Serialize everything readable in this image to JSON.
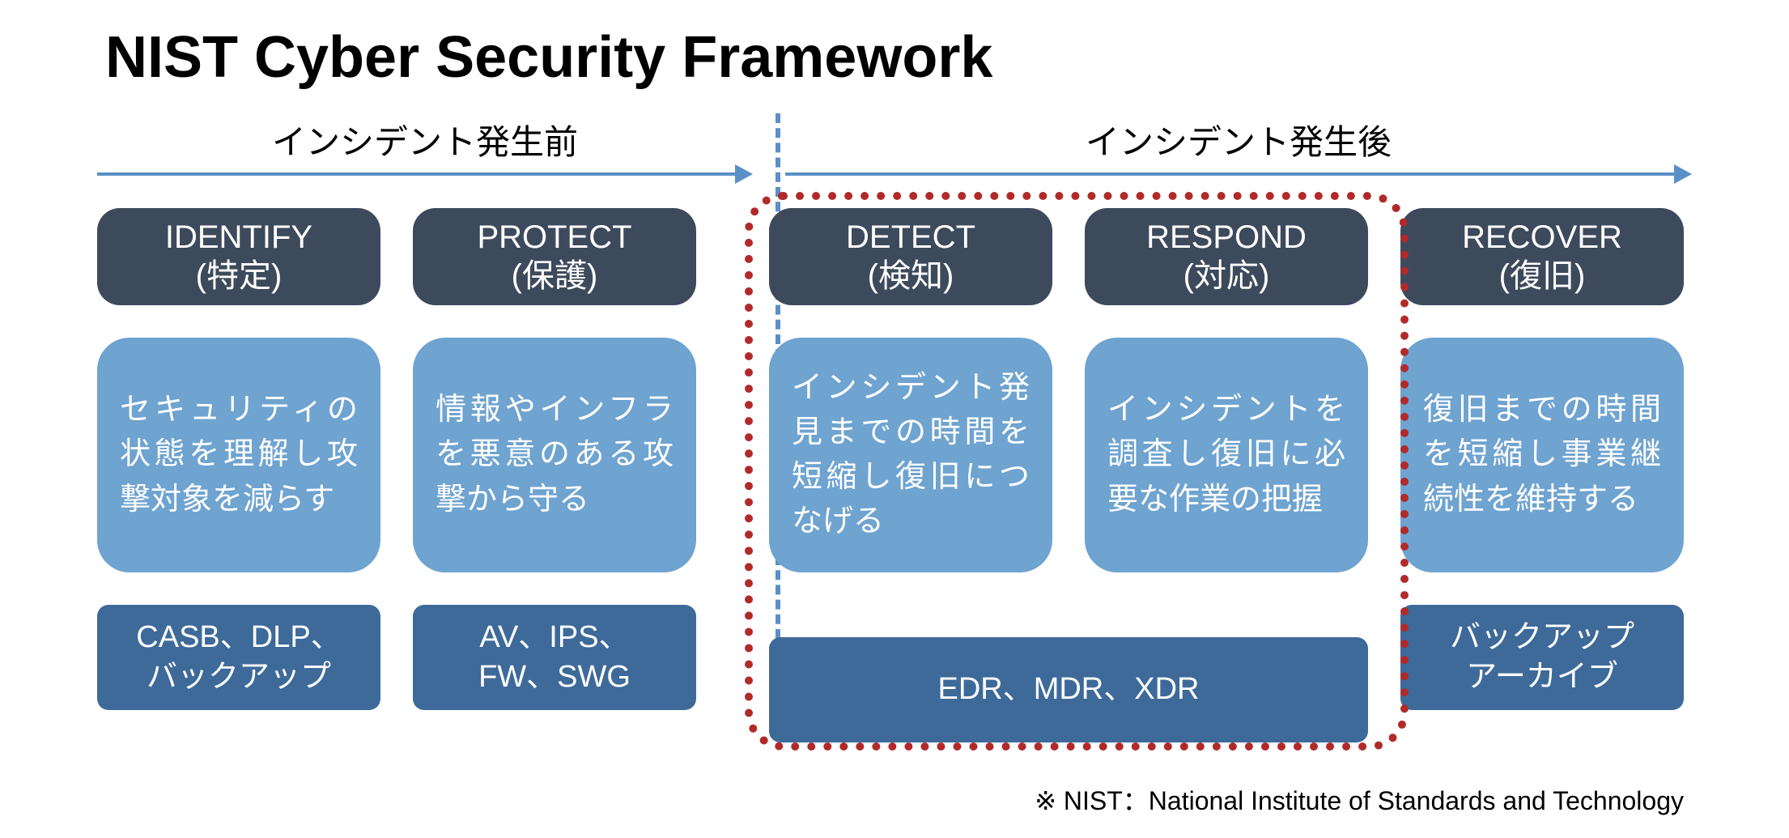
{
  "title": "NIST Cyber Security Framework",
  "phases": {
    "pre": "インシデント発生前",
    "post": "インシデント発生後"
  },
  "columns": [
    {
      "header_en": "IDENTIFY",
      "header_jp": "(特定)",
      "desc": "セキュリティの状態を理解し攻撃対象を減らす",
      "tools": "CASB、DLP、\nバックアップ"
    },
    {
      "header_en": "PROTECT",
      "header_jp": "(保護)",
      "desc": "情報やインフラを悪意のある攻撃から守る",
      "tools": "AV、IPS、\nFW、SWG"
    },
    {
      "header_en": "DETECT",
      "header_jp": "(検知)",
      "desc": "インシデント発見までの時間を短縮し復旧につなげる",
      "tools": ""
    },
    {
      "header_en": "RESPOND",
      "header_jp": "(対応)",
      "desc": "インシデントを調査し復旧に必要な作業の把握",
      "tools": ""
    },
    {
      "header_en": "RECOVER",
      "header_jp": "(復旧)",
      "desc": "復旧までの時間を短縮し事業継続性を維持する",
      "tools": "バックアップ\nアーカイブ"
    }
  ],
  "merged_tools_34": "EDR、MDR、XDR",
  "footnote": "※ NIST：National Institute of Standards and Technology",
  "colors": {
    "arrow": "#5b8fc7",
    "pill_bg": "#3d4a5c",
    "desc_bg": "#6fa3d0",
    "tool_bg": "#3e6a9a",
    "highlight": "#b12a2a"
  }
}
